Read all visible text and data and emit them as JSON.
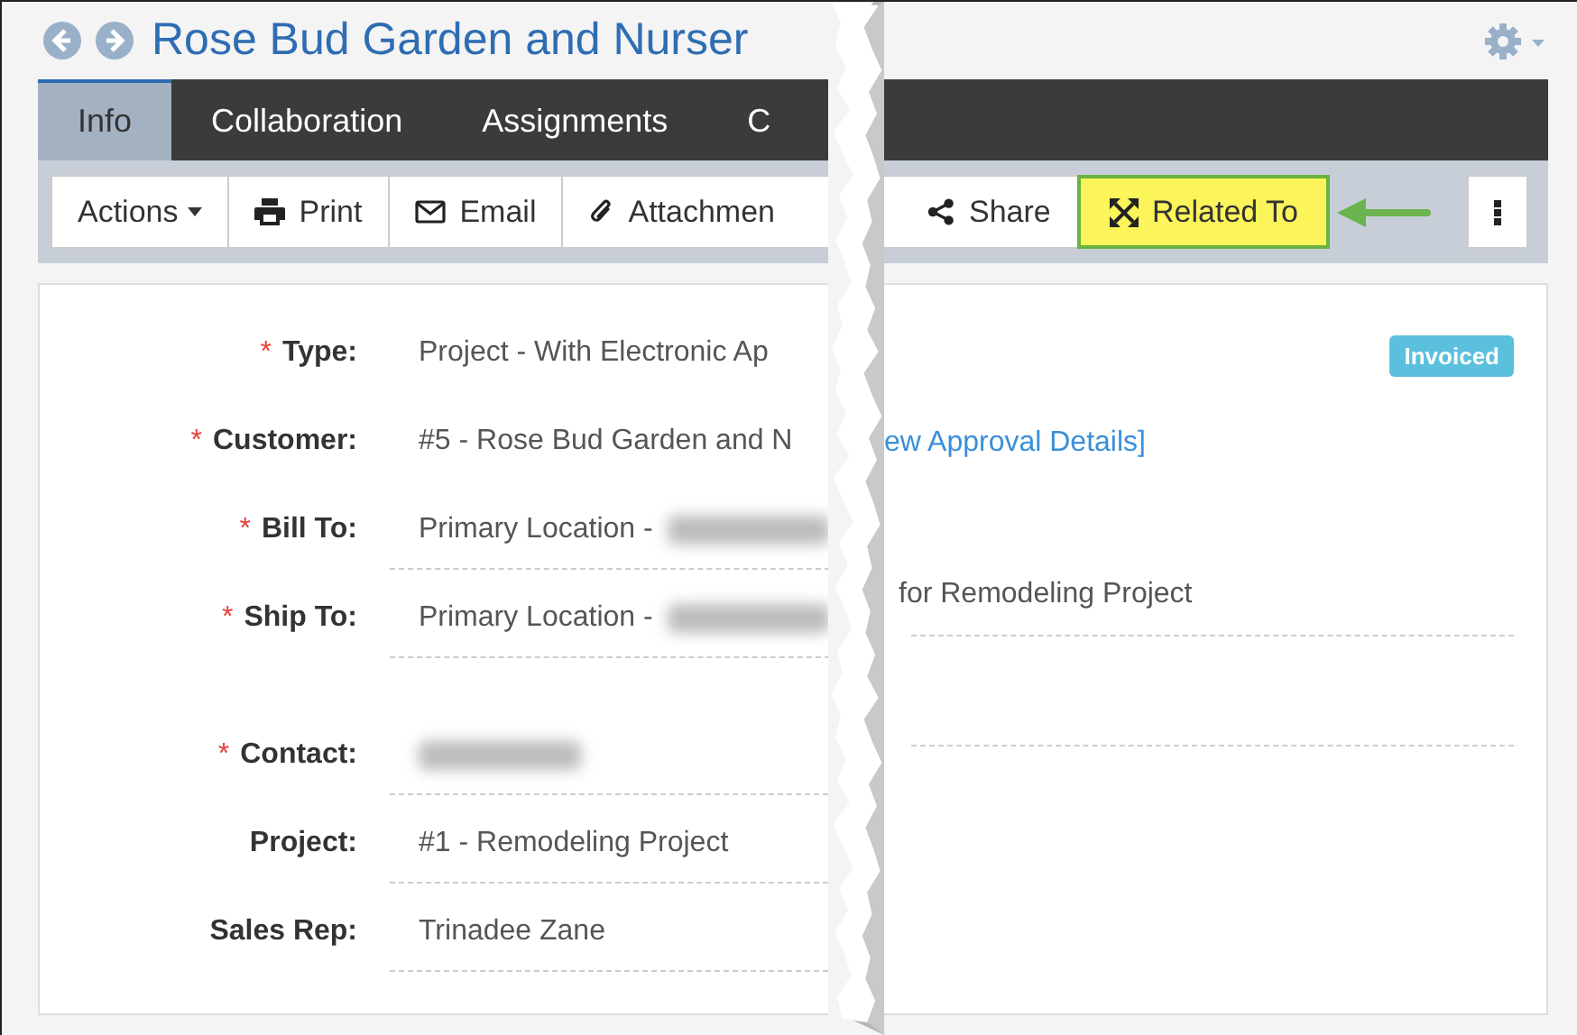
{
  "header": {
    "title": "Rose Bud Garden and Nurser"
  },
  "tabs": [
    {
      "label": "Info",
      "selected": true
    },
    {
      "label": "Collaboration",
      "selected": false
    },
    {
      "label": "Assignments",
      "selected": false
    },
    {
      "label": "C",
      "selected": false
    }
  ],
  "toolbar_left": [
    {
      "label": "Actions",
      "kind": "dropdown"
    },
    {
      "label": "Print",
      "kind": "print"
    },
    {
      "label": "Email",
      "kind": "email"
    },
    {
      "label": "Attachmen",
      "kind": "attach"
    }
  ],
  "toolbar_right": [
    {
      "label": "Share",
      "kind": "share",
      "highlighted": false
    },
    {
      "label": "Related To",
      "kind": "related",
      "highlighted": true
    }
  ],
  "fields": [
    {
      "label": "Type:",
      "marker": "*",
      "value": "Project - With Electronic Ap",
      "underlined": false,
      "blurred": false
    },
    {
      "label": "Customer:",
      "marker": "*",
      "value": "#5 - Rose Bud Garden and N",
      "underlined": false,
      "blurred": false
    },
    {
      "label": "Bill To:",
      "marker": "*",
      "value": "Primary Location -",
      "underlined": true,
      "blurred": true
    },
    {
      "label": "Ship To:",
      "marker": "*",
      "value": "Primary Location -",
      "underlined": true,
      "blurred": true
    },
    {
      "kind": "spacer"
    },
    {
      "label": "Contact:",
      "marker": "*",
      "underlined": true,
      "blurred": true
    },
    {
      "label": "Project:",
      "value": "#1 - Remodeling Project",
      "underlined": true,
      "blurred": false
    },
    {
      "label": "Sales Rep:",
      "value": "Trinadee Zane",
      "underlined": true,
      "blurred": false
    }
  ],
  "status_badge": "Invoiced",
  "right_column": {
    "link": "ew Approval Details]",
    "description": "for Remodeling Project"
  }
}
